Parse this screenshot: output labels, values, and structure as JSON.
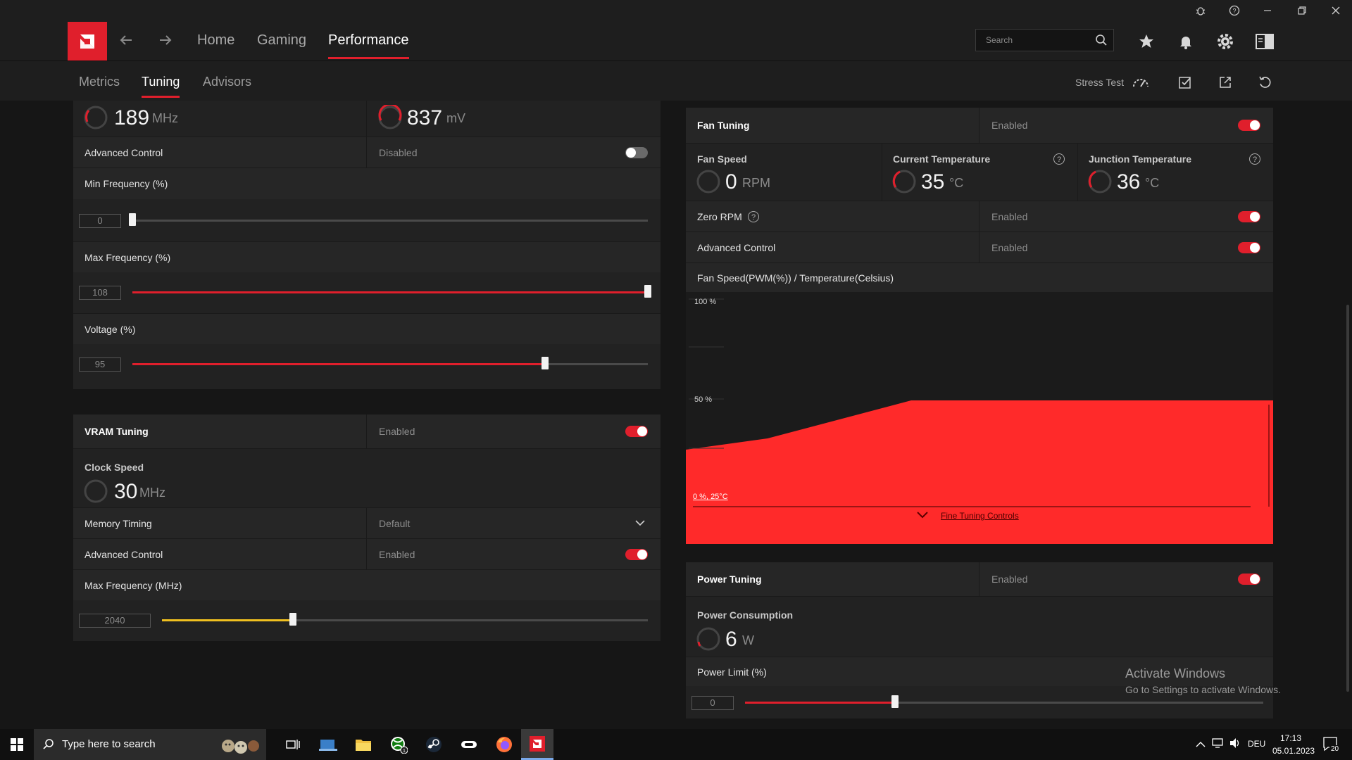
{
  "header": {
    "nav": [
      "Home",
      "Gaming",
      "Performance"
    ],
    "active_nav": "Performance",
    "search_placeholder": "Search"
  },
  "subnav": {
    "tabs": [
      "Metrics",
      "Tuning",
      "Advisors"
    ],
    "active_tab": "Tuning",
    "stress_test_label": "Stress Test"
  },
  "gpu": {
    "clock_value": "189",
    "clock_unit": "MHz",
    "voltage_value": "837",
    "voltage_unit": "mV",
    "advanced_control_label": "Advanced Control",
    "advanced_control_state": "Disabled",
    "min_freq_label": "Min Frequency (%)",
    "min_freq_value": "0",
    "max_freq_label": "Max Frequency (%)",
    "max_freq_value": "108",
    "voltage_label": "Voltage (%)",
    "voltage_pct_value": "95"
  },
  "vram": {
    "title": "VRAM Tuning",
    "state": "Enabled",
    "clock_label": "Clock Speed",
    "clock_value": "30",
    "clock_unit": "MHz",
    "memory_timing_label": "Memory Timing",
    "memory_timing_value": "Default",
    "advanced_control_label": "Advanced Control",
    "advanced_control_state": "Enabled",
    "max_freq_label": "Max Frequency (MHz)",
    "max_freq_value": "2040"
  },
  "fan": {
    "title": "Fan Tuning",
    "state": "Enabled",
    "speed_label": "Fan Speed",
    "speed_value": "0",
    "speed_unit": "RPM",
    "current_temp_label": "Current Temperature",
    "current_temp_value": "35",
    "temp_unit": "°C",
    "junction_temp_label": "Junction Temperature",
    "junction_temp_value": "36",
    "zero_rpm_label": "Zero RPM",
    "zero_rpm_state": "Enabled",
    "advanced_control_label": "Advanced Control",
    "advanced_control_state": "Enabled",
    "curve_title": "Fan Speed(PWM(%)) / Temperature(Celsius)",
    "y_label_100": "100 %",
    "y_label_50": "50 %",
    "origin_label": "0 %, 25°C",
    "fine_tuning_label": "Fine Tuning Controls"
  },
  "power": {
    "title": "Power Tuning",
    "state": "Enabled",
    "consumption_label": "Power Consumption",
    "consumption_value": "6",
    "consumption_unit": "W",
    "limit_label": "Power Limit (%)",
    "limit_value": "0"
  },
  "watermark": {
    "line1": "Activate Windows",
    "line2": "Go to Settings to activate Windows."
  },
  "taskbar": {
    "search_text": "Type here to search",
    "language": "DEU",
    "time": "17:13",
    "date": "05.01.2023",
    "notification_count": "20"
  },
  "sliders": {
    "min_freq": 0.0,
    "max_freq": 1.0,
    "voltage": 0.8,
    "vram_max_freq": 0.27,
    "power_limit": 0.29
  },
  "colors": {
    "accent": "#e01f2c",
    "vram_slider": "#f0c020",
    "fan_curve_fill": "#ff2a2a"
  }
}
